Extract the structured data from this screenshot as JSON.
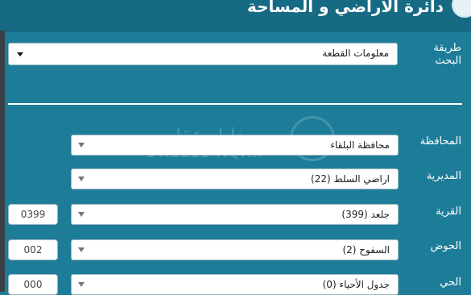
{
  "header": {
    "title": "دائرة الاراضي و المساحة"
  },
  "search": {
    "label": "طريقة البحث",
    "value": "معلومات القطعة"
  },
  "fields": {
    "governorate": {
      "label": "المحافظة",
      "value": "محافظة البلقاء"
    },
    "directorate": {
      "label": "المديرية",
      "value": "اراضي السلط (22)"
    },
    "village": {
      "label": "القرية",
      "value": "جلعد (399)",
      "code": "0399"
    },
    "basin": {
      "label": "الحوض",
      "value": "السفوح (2)",
      "code": "002"
    },
    "neighborhood": {
      "label": "الحي",
      "value": "جدول الأحياء (0)",
      "code": "000"
    }
  },
  "watermark": {
    "arabic": "دليل عقار",
    "english": "DALEEL AQAR"
  }
}
